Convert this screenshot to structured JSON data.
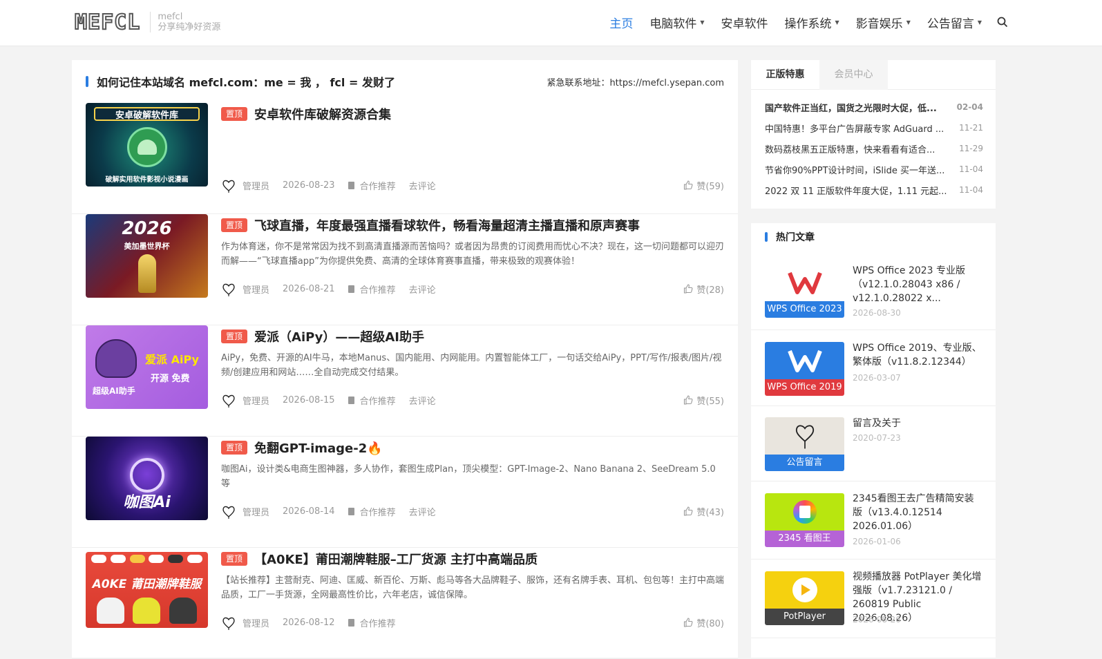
{
  "header": {
    "logo_mark": "MEFCL",
    "logo_line1": "mefcl",
    "logo_line2": "分享纯净好资源",
    "nav": [
      {
        "label": "主页",
        "active": true,
        "dropdown": false
      },
      {
        "label": "电脑软件",
        "active": false,
        "dropdown": true
      },
      {
        "label": "安卓软件",
        "active": false,
        "dropdown": false
      },
      {
        "label": "操作系统",
        "active": false,
        "dropdown": true
      },
      {
        "label": "影音娱乐",
        "active": false,
        "dropdown": true
      },
      {
        "label": "公告留言",
        "active": false,
        "dropdown": true
      }
    ],
    "search_icon": "search-icon"
  },
  "notice": {
    "title": "如何记住本站域名 mefcl.com：me = 我 ， fcl = 发财了",
    "contact": "紧急联系地址：https://mefcl.ysepan.com"
  },
  "posts": [
    {
      "pin": "置顶",
      "title": "安卓软件库破解资源合集",
      "thumb_line1": "安卓破解软件库",
      "thumb_line2": "破解实用软件影视小说漫画",
      "excerpt": "",
      "author": "管理员",
      "date": "2026-08-23",
      "category": "合作推荐",
      "comment": "去评论",
      "likes": "赞(59)"
    },
    {
      "pin": "置顶",
      "title": "飞球直播，年度最强直播看球软件，畅看海量超清主播直播和原声赛事",
      "thumb_line1": "2026",
      "thumb_line2": "美加墨世界杯",
      "excerpt": "作为体育迷，你不是常常因为找不到高清直播源而苦恼吗？或者因为昂贵的订阅费用而忧心不决？现在，这一切问题都可以迎刃而解——“飞球直播app”为你提供免费、高清的全球体育赛事直播，带来极致的观赛体验！",
      "author": "管理员",
      "date": "2026-08-21",
      "category": "合作推荐",
      "comment": "去评论",
      "likes": "赞(28)"
    },
    {
      "pin": "置顶",
      "title": "爱派（AiPy）——超级AI助手",
      "thumb_line1": "爱派 AiPy",
      "thumb_line2": "开源 免费",
      "thumb_line3": "超级AI助手",
      "excerpt": "AiPy，免费、开源的AI牛马，本地Manus、国内能用、内网能用。内置智能体工厂，一句话交给AiPy，PPT/写作/报表/图片/视频/创建应用和网站……全自动完成交付结果。",
      "author": "管理员",
      "date": "2026-08-15",
      "category": "合作推荐",
      "comment": "去评论",
      "likes": "赞(55)"
    },
    {
      "pin": "置顶",
      "title": "免翻GPT-image-2🔥",
      "thumb_line1": "咖图Ai",
      "excerpt": "咖图Ai，设计类&电商生图神器，多人协作，套图生成Plan，顶尖模型：GPT-Image-2、Nano Banana 2、SeeDream 5.0 等",
      "author": "管理员",
      "date": "2026-08-14",
      "category": "合作推荐",
      "comment": "去评论",
      "likes": "赞(43)"
    },
    {
      "pin": "置顶",
      "title": "【A0KE】莆田潮牌鞋服–工厂货源 主打中高端品质",
      "thumb_line1": "A0KE 莆田潮牌鞋服",
      "excerpt": "【站长推荐】主营耐克、阿迪、匡威、新百伦、万斯、彪马等各大品牌鞋子、服饰，还有名牌手表、耳机、包包等！主打中高端品质，工厂一手货源，全网最高性价比，六年老店，诚信保障。",
      "author": "管理员",
      "date": "2026-08-12",
      "category": "合作推荐",
      "comment": "",
      "likes": "赞(80)"
    }
  ],
  "sidebar": {
    "tabs": [
      "正版特惠",
      "会员中心"
    ],
    "deals": [
      {
        "title": "国产软件正当红，国货之光限时大促，低...",
        "date": "02-04",
        "bold": true
      },
      {
        "title": "中国特惠！多平台广告屏蔽专家 AdGuard ...",
        "date": "11-21",
        "bold": false
      },
      {
        "title": "数码荔枝黑五正版特惠，快来看看有适合...",
        "date": "11-29",
        "bold": false
      },
      {
        "title": "节省你90%PPT设计时间，iSlide 买一年送...",
        "date": "11-04",
        "bold": false
      },
      {
        "title": "2022 双 11 正版软件年度大促，1.11 元起...",
        "date": "11-04",
        "bold": false
      }
    ],
    "hot_title": "热门文章",
    "hot": [
      {
        "caption": "WPS Office 2023",
        "title": "WPS Office 2023 专业版（v12.1.0.28043 x86 / v12.1.0.28022 x...",
        "date": "2026-08-30",
        "color": "#2a7de1"
      },
      {
        "caption": "WPS Office 2019",
        "title": "WPS Office 2019、专业版、繁体版（v11.8.2.12344）",
        "date": "2026-03-07",
        "color": "#e0393e"
      },
      {
        "caption": "公告留言",
        "title": "留言及关于",
        "date": "2020-07-23",
        "color": "#2a7de1"
      },
      {
        "caption": "2345 看图王",
        "title": "2345看图王去广告精简安装版（v13.4.0.12514 2026.01.06）",
        "date": "2026-01-06",
        "color": "#b563d6"
      },
      {
        "caption": "PotPlayer",
        "title": "视频播放器 PotPlayer 美化增强版（v1.7.23121.0 / 260819 Public 2026.08.26）",
        "date": "2026-08-26",
        "color": "#444444"
      }
    ]
  }
}
